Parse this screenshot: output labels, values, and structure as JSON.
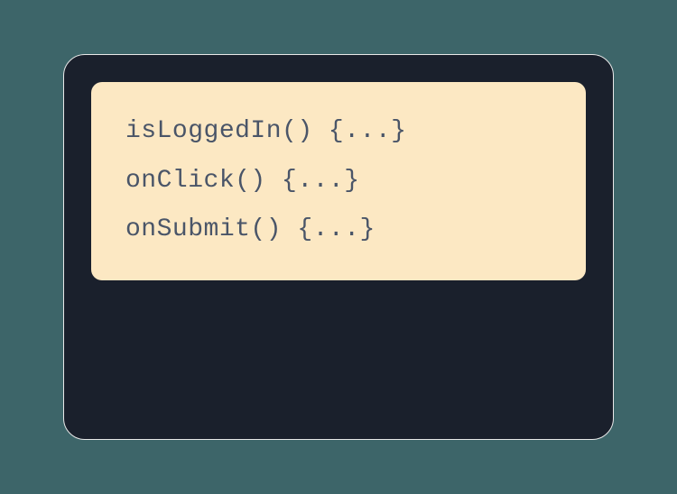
{
  "code": {
    "lines": [
      "isLoggedIn() {...}",
      "onClick() {...}",
      "onSubmit() {...}"
    ]
  }
}
